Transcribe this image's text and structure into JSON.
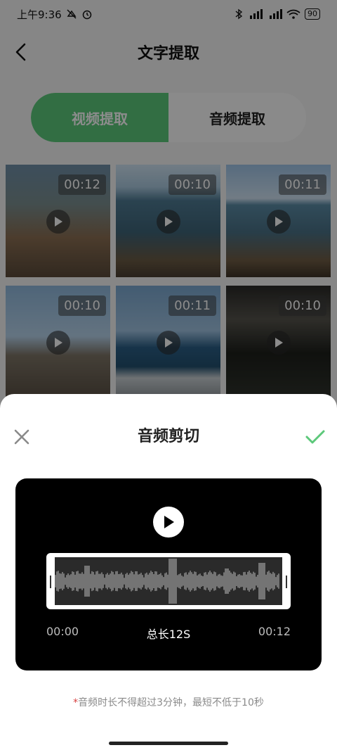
{
  "status_bar": {
    "time": "上午9:36",
    "battery": "90",
    "icons": [
      "mute-icon",
      "alarm-icon",
      "bluetooth-icon",
      "signal-hd-icon",
      "signal-hd-icon",
      "wifi-icon",
      "battery-icon"
    ]
  },
  "header": {
    "title": "文字提取",
    "back_icon": "chevron-left-icon"
  },
  "tabs": [
    {
      "label": "视频提取",
      "active": true
    },
    {
      "label": "音频提取",
      "active": false
    }
  ],
  "videos": [
    {
      "duration": "00:12"
    },
    {
      "duration": "00:10"
    },
    {
      "duration": "00:11"
    },
    {
      "duration": "00:10"
    },
    {
      "duration": "00:11"
    },
    {
      "duration": "00:10"
    }
  ],
  "sheet": {
    "title": "音频剪切",
    "close_icon": "close-icon",
    "confirm_icon": "check-icon",
    "start_time": "00:00",
    "total_label": "总长12S",
    "end_time": "00:12",
    "hint_star": "*",
    "hint": "音频时长不得超过3分钟，最短不低于10秒"
  },
  "colors": {
    "accent_green": "#5cc87a",
    "player_bg": "#000000",
    "waveform": "#bdbdbd"
  }
}
